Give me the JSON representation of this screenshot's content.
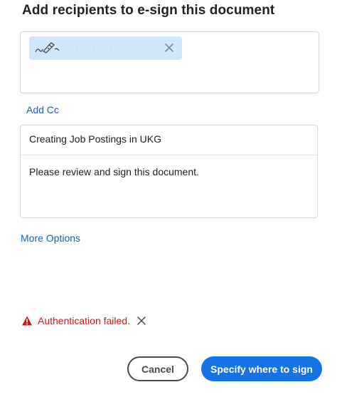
{
  "dialog": {
    "title": "Add recipients to e-sign this document"
  },
  "recipients": {
    "chip": {
      "icon": "signature-pen-icon",
      "masked_name": "· · ·",
      "close_icon": "close-icon"
    }
  },
  "add_cc_label": "Add Cc",
  "message": {
    "subject": "Creating Job Postings in UKG",
    "body": "Please review and sign this document."
  },
  "more_options_label": "More Options",
  "error": {
    "icon": "warning-icon",
    "text": "Authentication failed.",
    "close_icon": "close-icon",
    "color": "#d31510"
  },
  "buttons": {
    "cancel_label": "Cancel",
    "primary_label": "Specify where to sign"
  },
  "colors": {
    "accent": "#1473e6",
    "link": "#1a5fb4",
    "chip_bg": "#cfe6fb"
  }
}
